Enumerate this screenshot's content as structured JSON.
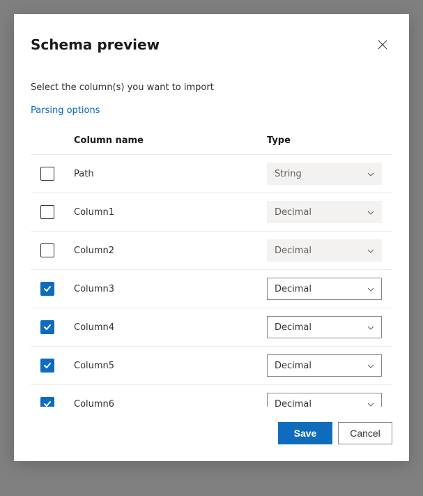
{
  "dialog": {
    "title": "Schema preview",
    "instruction": "Select the column(s) you want to import",
    "parsing_link": "Parsing options"
  },
  "headers": {
    "name": "Column name",
    "type": "Type"
  },
  "rows": [
    {
      "checked": false,
      "name": "Path",
      "type": "String",
      "enabled": false
    },
    {
      "checked": false,
      "name": "Column1",
      "type": "Decimal",
      "enabled": false
    },
    {
      "checked": false,
      "name": "Column2",
      "type": "Decimal",
      "enabled": false
    },
    {
      "checked": true,
      "name": "Column3",
      "type": "Decimal",
      "enabled": true
    },
    {
      "checked": true,
      "name": "Column4",
      "type": "Decimal",
      "enabled": true
    },
    {
      "checked": true,
      "name": "Column5",
      "type": "Decimal",
      "enabled": true
    },
    {
      "checked": true,
      "name": "Column6",
      "type": "Decimal",
      "enabled": true
    }
  ],
  "footer": {
    "save": "Save",
    "cancel": "Cancel"
  }
}
